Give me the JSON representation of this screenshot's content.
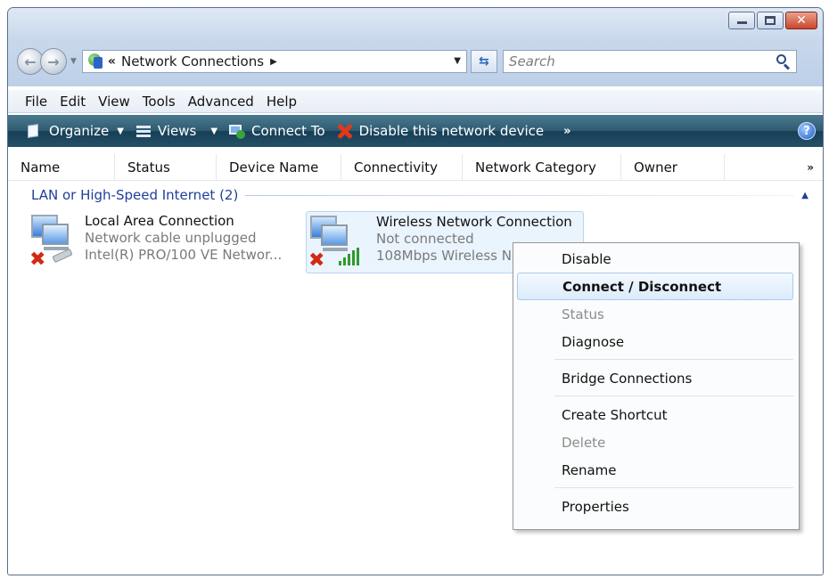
{
  "address": {
    "breadcrumb_prefix": "«",
    "location": "Network Connections"
  },
  "search": {
    "placeholder": "Search"
  },
  "menubar": [
    "File",
    "Edit",
    "View",
    "Tools",
    "Advanced",
    "Help"
  ],
  "toolbar": {
    "organize": "Organize",
    "views": "Views",
    "connect_to": "Connect To",
    "disable_device": "Disable this network device",
    "more": "»"
  },
  "columns": [
    "Name",
    "Status",
    "Device Name",
    "Connectivity",
    "Network Category",
    "Owner"
  ],
  "group": {
    "label": "LAN or High-Speed Internet (2)"
  },
  "connections": [
    {
      "name": "Local Area Connection",
      "status": "Network cable unplugged",
      "device": "Intel(R) PRO/100 VE Networ..."
    },
    {
      "name": "Wireless Network Connection",
      "status": "Not connected",
      "device": "108Mbps Wireless Ne"
    }
  ],
  "context_menu": {
    "disable": "Disable",
    "connect_disconnect": "Connect / Disconnect",
    "status": "Status",
    "diagnose": "Diagnose",
    "bridge": "Bridge Connections",
    "create_shortcut": "Create Shortcut",
    "delete": "Delete",
    "rename": "Rename",
    "properties": "Properties"
  },
  "colors": {
    "command_bar": "#245068",
    "group_text": "#1e3f9a",
    "selection_fill": "#eaf4fd",
    "error_red": "#d02a13",
    "signal_green": "#2e9a2e"
  }
}
